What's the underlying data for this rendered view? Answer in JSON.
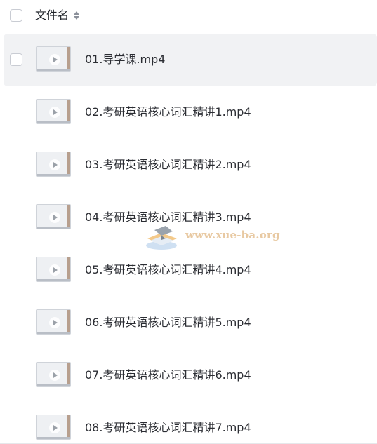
{
  "header": {
    "column_label": "文件名"
  },
  "files": [
    {
      "name": "01.导学课.mp4",
      "selected": true
    },
    {
      "name": "02.考研英语核心词汇精讲1.mp4",
      "selected": false
    },
    {
      "name": "03.考研英语核心词汇精讲2.mp4",
      "selected": false
    },
    {
      "name": "04.考研英语核心词汇精讲3.mp4",
      "selected": false
    },
    {
      "name": "05.考研英语核心词汇精讲4.mp4",
      "selected": false
    },
    {
      "name": "06.考研英语核心词汇精讲5.mp4",
      "selected": false
    },
    {
      "name": "07.考研英语核心词汇精讲6.mp4",
      "selected": false
    },
    {
      "name": "08.考研英语核心词汇精讲7.mp4",
      "selected": false
    }
  ],
  "watermark": {
    "text": "www.xue-ba.org"
  },
  "colors": {
    "selected_row_bg": "#f1f2f4",
    "text": "#2b2d33",
    "watermark": "#e8c9a2"
  }
}
